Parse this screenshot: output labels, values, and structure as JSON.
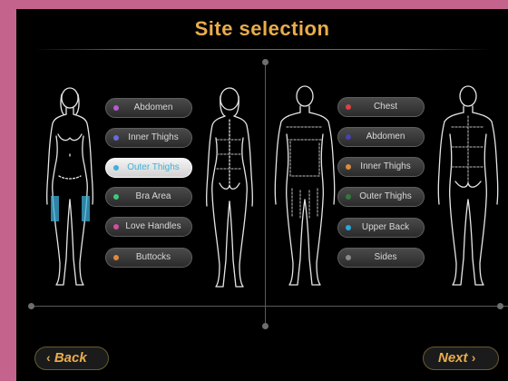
{
  "header": {
    "title": "Site selection"
  },
  "colors": {
    "accent": "#e8ad4c",
    "selected_text": "#3fb0d9"
  },
  "female": {
    "options": [
      {
        "label": "Abdomen",
        "dot": "#b85ad0"
      },
      {
        "label": "Inner Thighs",
        "dot": "#6a6ae0"
      },
      {
        "label": "Outer Thighs",
        "dot": "#3fb0d9",
        "selected": true
      },
      {
        "label": "Bra Area",
        "dot": "#3ec97a"
      },
      {
        "label": "Love Handles",
        "dot": "#d04ea0"
      },
      {
        "label": "Buttocks",
        "dot": "#e08a3a"
      }
    ]
  },
  "male": {
    "options": [
      {
        "label": "Chest",
        "dot": "#e04040"
      },
      {
        "label": "Abdomen",
        "dot": "#4a40b0"
      },
      {
        "label": "Inner Thighs",
        "dot": "#e08a3a"
      },
      {
        "label": "Outer Thighs",
        "dot": "#2e7a3a"
      },
      {
        "label": "Upper Back",
        "dot": "#2aa8e0"
      },
      {
        "label": "Sides",
        "dot": "#8a8a8a"
      }
    ]
  },
  "footer": {
    "back_label": "Back",
    "back_icon": "chevron-left-icon",
    "next_label": "Next",
    "next_icon": "chevron-right-icon"
  }
}
